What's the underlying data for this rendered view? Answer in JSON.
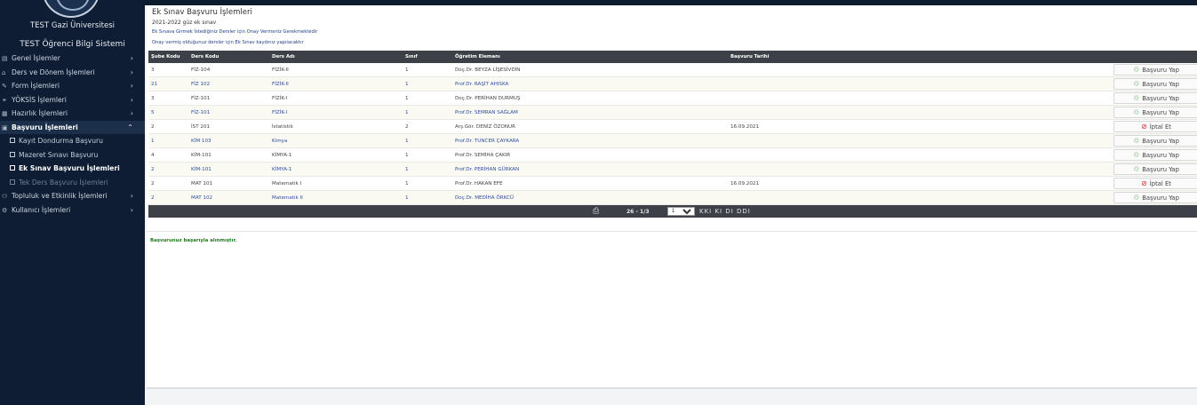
{
  "sidebar": {
    "university": "TEST Gazi Üniversitesi",
    "system": "TEST Öğrenci Bilgi Sistemi",
    "menu": [
      {
        "label": "Genel İşlemler",
        "icon": "▤",
        "icon_name": "grid-icon",
        "chevron": "›"
      },
      {
        "label": "Ders ve Dönem İşlemleri",
        "icon": "⌂",
        "icon_name": "book-icon",
        "chevron": "›"
      },
      {
        "label": "Form İşlemleri",
        "icon": "✎",
        "icon_name": "form-icon",
        "chevron": "›"
      },
      {
        "label": "YÖKSİS İşlemleri",
        "icon": "⚭",
        "icon_name": "users-icon",
        "chevron": "›"
      },
      {
        "label": "Hazırlık İşlemleri",
        "icon": "▦",
        "icon_name": "keyboard-icon",
        "chevron": "›"
      },
      {
        "label": "Başvuru İşlemleri",
        "icon": "▣",
        "icon_name": "application-icon",
        "chevron": "⌃"
      }
    ],
    "submenu": [
      {
        "label": "Kayıt Dondurma Başvuru"
      },
      {
        "label": "Mazeret Sınavı Başvuru"
      },
      {
        "label": "Ek Sınav Başvuru İşlemleri"
      },
      {
        "label": "Tek Ders Başvuru İşlemleri"
      }
    ],
    "menu2": [
      {
        "label": "Topluluk ve Etkinlik İşlemleri",
        "icon": "⚇",
        "icon_name": "community-icon",
        "chevron": "›"
      },
      {
        "label": "Kullanıcı İşlemleri",
        "icon": "⚙",
        "icon_name": "user-settings-icon",
        "chevron": "›"
      }
    ]
  },
  "page": {
    "title": "Ek Sınav Başvuru İşlemleri",
    "term": "2021-2022 güz ek sınav",
    "note1": "Ek Sınava Girmek İstediğiniz Dersler için Onay Vermeniz Gerekmektedir",
    "note2": "Onay vermiş olduğunuz dersler için Ek Sınav kaydınız yapılacaktır",
    "success": "Başvurunuz başarıyla alınmıştır."
  },
  "table": {
    "headers": [
      "Şube Kodu",
      "Ders Kodu",
      "Ders Adı",
      "Sınıf",
      "Öğretim Elemanı",
      "Başvuru Tarihi",
      ""
    ],
    "rows": [
      {
        "sube": "3",
        "kod": "FİZ-104",
        "ad": "FİZİK-II",
        "sinif": "1",
        "hoca": "Doç.Dr. BEYZA LİŞESİVDİN",
        "tarih": "",
        "action": "Başvuru Yap",
        "type": "apply",
        "link": false
      },
      {
        "sube": "21",
        "kod": "FİZ 102",
        "ad": "FİZİK-II",
        "sinif": "1",
        "hoca": "Prof.Dr. RAŞİT AHISKA",
        "tarih": "",
        "action": "Başvuru Yap",
        "type": "apply",
        "link": true
      },
      {
        "sube": "3",
        "kod": "FİZ-101",
        "ad": "FİZİK-I",
        "sinif": "1",
        "hoca": "Doç.Dr. PERİHAN DURMUŞ",
        "tarih": "",
        "action": "Başvuru Yap",
        "type": "apply",
        "link": false
      },
      {
        "sube": "5",
        "kod": "FİZ-101",
        "ad": "FİZİK-I",
        "sinif": "1",
        "hoca": "Prof.Dr. SEMRAN SAĞLAM",
        "tarih": "",
        "action": "Başvuru Yap",
        "type": "apply",
        "link": true
      },
      {
        "sube": "2",
        "kod": "İST 201",
        "ad": "İstatistik",
        "sinif": "2",
        "hoca": "Arş.Gör. DENİZ ÖZONUR",
        "tarih": "16.09.2021",
        "action": "İptal Et",
        "type": "cancel",
        "link": false
      },
      {
        "sube": "1",
        "kod": "KİM 103",
        "ad": "Kimya",
        "sinif": "1",
        "hoca": "Prof.Dr. TUNCER ÇAYKARA",
        "tarih": "",
        "action": "Başvuru Yap",
        "type": "apply",
        "link": true
      },
      {
        "sube": "4",
        "kod": "KİM-101",
        "ad": "KİMYA-1",
        "sinif": "1",
        "hoca": "Prof.Dr. SEMİHA ÇAKIR",
        "tarih": "",
        "action": "Başvuru Yap",
        "type": "apply",
        "link": false
      },
      {
        "sube": "2",
        "kod": "KİM-101",
        "ad": "KİMYA-1",
        "sinif": "1",
        "hoca": "Prof.Dr. PERİHAN GÜRKAN",
        "tarih": "",
        "action": "Başvuru Yap",
        "type": "apply",
        "link": true
      },
      {
        "sube": "2",
        "kod": "MAT 101",
        "ad": "Matematik I",
        "sinif": "1",
        "hoca": "Prof.Dr. HAKAN EFE",
        "tarih": "16.09.2021",
        "action": "İptal Et",
        "type": "cancel",
        "link": false
      },
      {
        "sube": "2",
        "kod": "MAT 102",
        "ad": "Matematik II",
        "sinif": "1",
        "hoca": "Doç.Dr. MEDİHA ÖRKCÜ",
        "tarih": "",
        "action": "Başvuru Yap",
        "type": "apply",
        "link": true
      }
    ]
  },
  "pager": {
    "count": "26 - 1/3",
    "page_select": "1",
    "nav": "KKI KI DI DDI"
  },
  "colors": {
    "sidebar_bg": "#0e1d33",
    "header_bg": "#3d4046",
    "link": "#2d4fa0",
    "apply_icon": "#2e9a3a",
    "cancel_icon": "#d62828"
  }
}
